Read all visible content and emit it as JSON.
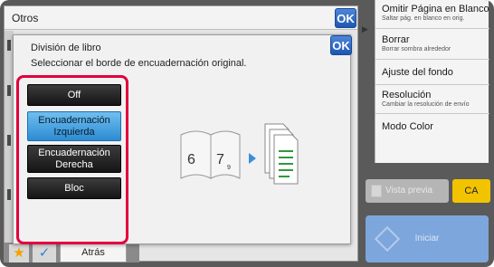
{
  "base_dialog": {
    "title": "Otros",
    "ok_label": "OK"
  },
  "dialog": {
    "title": "División de libro",
    "subtitle": "Seleccionar el borde de encuadernación original.",
    "ok_label": "OK",
    "options": [
      {
        "label": "Off",
        "selected": false
      },
      {
        "label": "Encuadernación Izquierda",
        "selected": true
      },
      {
        "label": "Encuadernación Derecha",
        "selected": false
      },
      {
        "label": "Bloc",
        "selected": false
      }
    ],
    "illustration": {
      "page_number_left": "6",
      "page_number_right": "7",
      "page_number_sub": "9"
    }
  },
  "right_panel": {
    "items": [
      {
        "title": "Omitir Página en Blanco",
        "sub": "Saltar pág. en blanco en orig."
      },
      {
        "title": "Borrar",
        "sub": "Borrar sombra alrededor"
      },
      {
        "title": "Ajuste del fondo",
        "sub": ""
      },
      {
        "title": "Resolución",
        "sub": "Cambiar la resolución de envío"
      },
      {
        "title": "Modo Color",
        "sub": ""
      }
    ]
  },
  "actions": {
    "preview_label": "Vista previa",
    "ca_label": "CA",
    "start_label": "Iniciar",
    "back_label": "Atrás"
  },
  "colors": {
    "accent": "#2d8bd2",
    "highlight_frame": "#e2003c",
    "ca": "#f2c400",
    "start": "#7da6dc"
  }
}
